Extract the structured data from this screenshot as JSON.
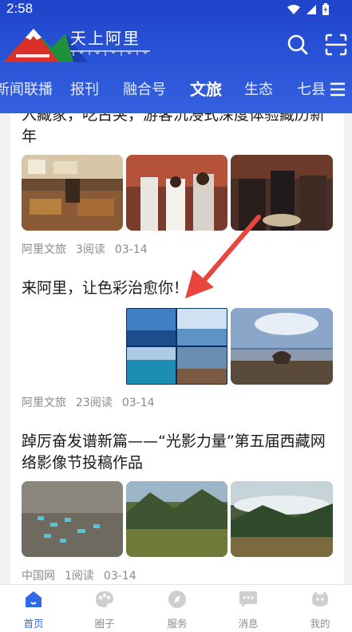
{
  "status": {
    "time": "2:58"
  },
  "app": {
    "logo_text": "天上阿里"
  },
  "tabs": [
    {
      "label": "新闻联播"
    },
    {
      "label": "报刊"
    },
    {
      "label": "融合号"
    },
    {
      "label": "文旅",
      "active": true
    },
    {
      "label": "生态"
    },
    {
      "label": "七县"
    }
  ],
  "articles": [
    {
      "title": "入藏家，吃古突，游客沉浸式深度体验藏历新年",
      "source": "阿里文旅",
      "reads": "3阅读",
      "date": "03-14"
    },
    {
      "title": "来阿里，让色彩治愈你！",
      "source": "阿里文旅",
      "reads": "23阅读",
      "date": "03-14"
    },
    {
      "title": "踔厉奋发谱新篇——“光影力量”第五届西藏网络影像节投稿作品",
      "source": "中国网",
      "reads": "1阅读",
      "date": "03-14"
    }
  ],
  "bottom_nav": [
    {
      "label": "首页",
      "icon": "home-icon",
      "active": true
    },
    {
      "label": "圈子",
      "icon": "palette-icon"
    },
    {
      "label": "服务",
      "icon": "compass-icon"
    },
    {
      "label": "消息",
      "icon": "chat-icon"
    },
    {
      "label": "我的",
      "icon": "profile-icon"
    }
  ],
  "colors": {
    "header": "#2a55d8",
    "accent": "#2f6be6",
    "arrow": "#e8453c"
  }
}
